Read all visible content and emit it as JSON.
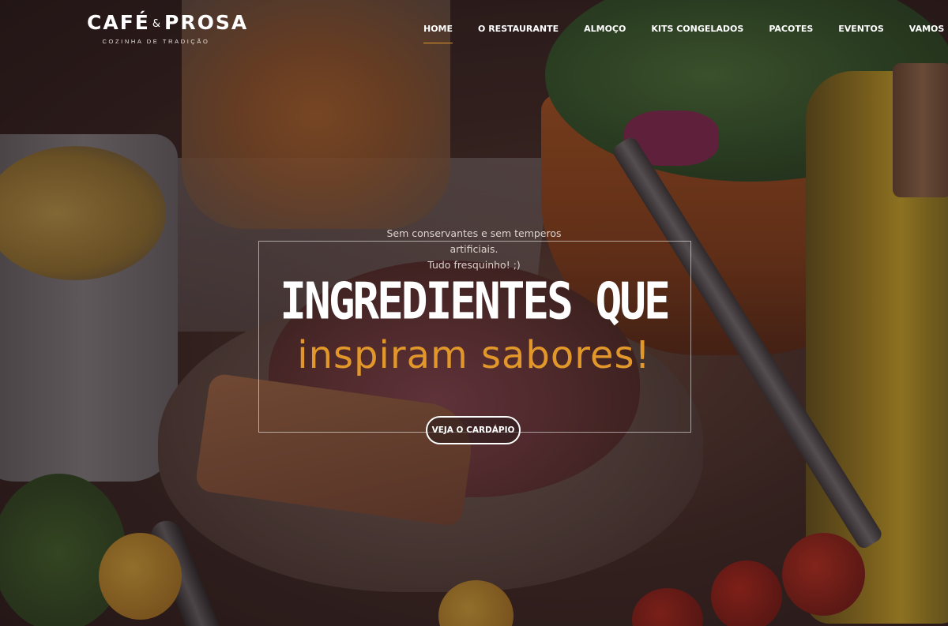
{
  "brand": {
    "name_left": "CAFÉ",
    "ampersand": "&",
    "name_right": "PROSA",
    "tagline": "COZINHA DE TRADIÇÃO"
  },
  "nav": {
    "items": [
      {
        "label": "HOME",
        "active": true
      },
      {
        "label": "O RESTAURANTE",
        "active": false
      },
      {
        "label": "ALMOÇO",
        "active": false
      },
      {
        "label": "KITS CONGELADOS",
        "active": false
      },
      {
        "label": "PACOTES",
        "active": false
      },
      {
        "label": "EVENTOS",
        "active": false
      },
      {
        "label": "VAMOS PROSAR",
        "active": false
      }
    ]
  },
  "hero": {
    "tagline_line1": "Sem conservantes e sem temperos artificiais.",
    "tagline_line2": "Tudo fresquinho! ;)",
    "title": "INGREDIENTES QUE",
    "subtitle": "inspiram sabores!",
    "cta_label": "VEJA O CARDÁPIO"
  },
  "colors": {
    "accent": "#e2972b",
    "overlay": "#231419",
    "text": "#ffffff"
  }
}
